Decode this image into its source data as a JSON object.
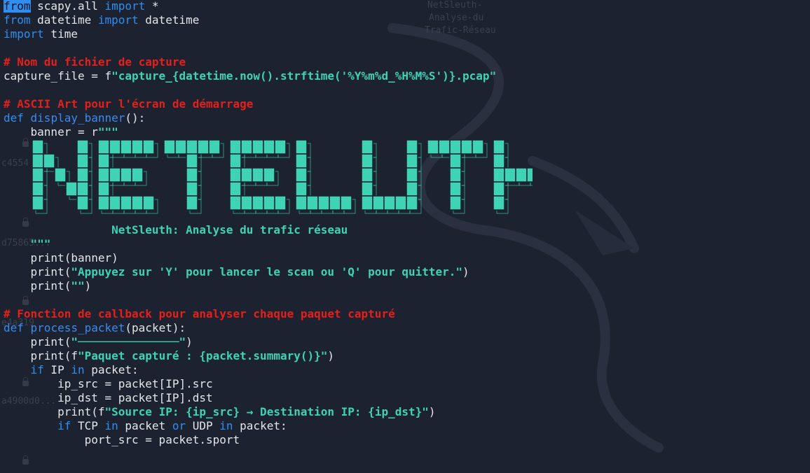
{
  "colors": {
    "background": "#1d2230",
    "keyword": "#2f8ff1",
    "comment": "#e3201b",
    "string": "#3fd3b5",
    "text": "#e4e6ea",
    "block_letter": "#3fd3b5"
  },
  "desktop_ghost": {
    "icon_label_lines": [
      "NetSleuth-",
      "Analyse-du",
      "Trafic-Réseau"
    ],
    "file_hashes": [
      "c4554",
      "d75865...",
      "e4a319",
      "a4900d0..."
    ]
  },
  "banner_block_text": "NETELUTH",
  "code": {
    "l1": {
      "kw_from": "from",
      "mod": " scapy.all ",
      "kw_import": "import",
      "rest": " *"
    },
    "l2": {
      "kw_from": "from",
      "mod": " datetime ",
      "kw_import": "import",
      "rest": " datetime"
    },
    "l3": {
      "kw_import": "import",
      "rest": " time"
    },
    "l5": {
      "comment": "# Nom du fichier de capture"
    },
    "l6": {
      "pre": "capture_file = f",
      "str": "\"capture_{datetime.now().strftime('%Y%m%d_%H%M%S')}.pcap\""
    },
    "l8": {
      "comment": "# ASCII Art pour l'écran de démarrage"
    },
    "l9": {
      "kw_def": "def",
      "name": " display_banner",
      "rest": "():"
    },
    "l10": {
      "pre": "    banner = r",
      "str": "\"\"\""
    },
    "l17": {
      "str": "                NetSleuth: Analyse du trafic réseau"
    },
    "l18": {
      "str": "    \"\"\""
    },
    "l19": {
      "text": "    print(banner)"
    },
    "l20": {
      "pre": "    print(",
      "str": "\"Appuyez sur 'Y' pour lancer le scan ou 'Q' pour quitter.\"",
      "post": ")"
    },
    "l21": {
      "pre": "    print(",
      "str": "\"\"",
      "post": ")"
    },
    "l23": {
      "comment": "# Fonction de callback pour analyser chaque paquet capturé"
    },
    "l24": {
      "kw_def": "def",
      "name": " process_packet",
      "rest": "(packet):"
    },
    "l25": {
      "pre": "    print(",
      "str": "\"───────────────\"",
      "post": ")"
    },
    "l26": {
      "pre": "    print(f",
      "str": "\"Paquet capturé : {packet.summary()}\"",
      "post": ")"
    },
    "l27": {
      "pre": "    ",
      "kw_if": "if",
      "mid": " IP ",
      "kw_in": "in",
      "post": " packet:"
    },
    "l28": {
      "text": "        ip_src = packet[IP].src"
    },
    "l29": {
      "text": "        ip_dst = packet[IP].dst"
    },
    "l30": {
      "pre": "        print(f",
      "str": "\"Source IP: {ip_src} → Destination IP: {ip_dst}\"",
      "post": ")"
    },
    "l31": {
      "pre": "        ",
      "kw_if": "if",
      "mid1": " TCP ",
      "kw_in1": "in",
      "mid2": " packet ",
      "kw_or": "or",
      "mid3": " UDP ",
      "kw_in2": "in",
      "post": " packet:"
    },
    "l32": {
      "text": "            port_src = packet.sport"
    }
  }
}
